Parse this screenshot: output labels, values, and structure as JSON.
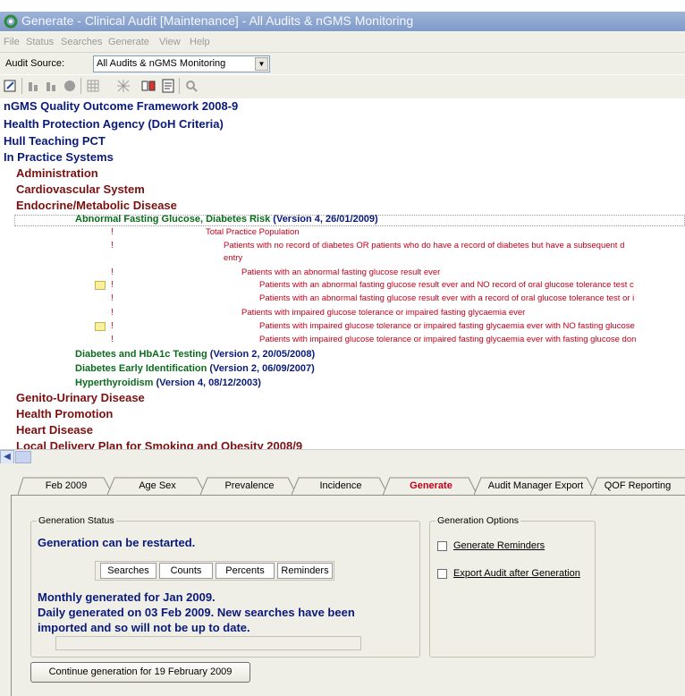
{
  "window": {
    "title": "Generate - Clinical Audit [Maintenance] - All Audits & nGMS Monitoring"
  },
  "menu": [
    "File",
    "Status",
    "Searches",
    "Generate",
    "View",
    "Help"
  ],
  "source": {
    "label": "Audit Source:",
    "value": "All Audits & nGMS Monitoring"
  },
  "toolbar": {
    "icons": [
      "edit-icon",
      "bars-icon",
      "bars-icon",
      "record-icon",
      "grid-icon",
      "grid-dots-icon",
      "compare-icon",
      "document-icon",
      "magnify-icon"
    ]
  },
  "tree": {
    "top": [
      "nGMS Quality Outcome Framework 2008-9",
      "Health Protection Agency (DoH Criteria)",
      "Hull Teaching PCT",
      "In Practice Systems"
    ],
    "categories_a": [
      "Administration",
      "Cardiovascular System",
      "Endocrine/Metabolic Disease"
    ],
    "selected": {
      "name": "Abnormal Fasting Glucose, Diabetes Risk",
      "version": "(Version 4, 26/01/2009)"
    },
    "rules": [
      "Total Practice Population",
      "Patients with no record of diabetes OR patients who do have a record of diabetes but have a subsequent d",
      "entry",
      "Patients with an abnormal fasting glucose result ever",
      "Patients with an abnormal fasting glucose result ever and NO record of oral glucose tolerance test c",
      "Patients with an abnormal fasting glucose result ever with a record of oral glucose tolerance test or i",
      "Patients with impaired glucose tolerance or impaired fasting glycaemia ever",
      "Patients with impaired glucose tolerance or impaired fasting glycaemia ever with NO fasting glucose",
      "Patients with impaired glucose tolerance or impaired fasting glycaemia ever with fasting glucose don"
    ],
    "audits": [
      {
        "name": "Diabetes and HbA1c Testing",
        "version": "(Version 2, 20/05/2008)"
      },
      {
        "name": "Diabetes Early Identification",
        "version": "(Version 2, 06/09/2007)"
      },
      {
        "name": "Hyperthyroidism",
        "version": "(Version 4, 08/12/2003)"
      }
    ],
    "categories_b": [
      "Genito-Urinary Disease",
      "Health Promotion",
      "Heart Disease",
      "Local Delivery Plan for Smoking and Obesity 2008/9"
    ]
  },
  "tabs": [
    "Feb 2009",
    "Age Sex",
    "Prevalence",
    "Incidence",
    "Generate",
    "Audit Manager Export",
    "QOF Reporting"
  ],
  "active_tab": "Generate",
  "generation_status": {
    "legend": "Generation Status",
    "status": "Generation can be restarted.",
    "phases": [
      "Searches",
      "Counts",
      "Percents",
      "Reminders"
    ],
    "monthly": "Monthly generated for Jan 2009.",
    "daily_1": "Daily generated on 03 Feb 2009. New searches have been",
    "daily_2": "imported and so will not be up to date."
  },
  "generation_options": {
    "legend": "Generation Options",
    "reminders": {
      "label": "Generate Reminders",
      "checked": false
    },
    "export": {
      "label": "Export Audit after Generation",
      "checked": false
    }
  },
  "continue_button": "Continue generation for 19 February 2009",
  "colors": {
    "title_bar": "#8aa4d0",
    "tree_top": "#0a1a7a",
    "tree_category": "#7b1010",
    "tree_audit": "#0b6b1c",
    "rule_text": "#c0001a",
    "active_tab": "#c0001a"
  }
}
